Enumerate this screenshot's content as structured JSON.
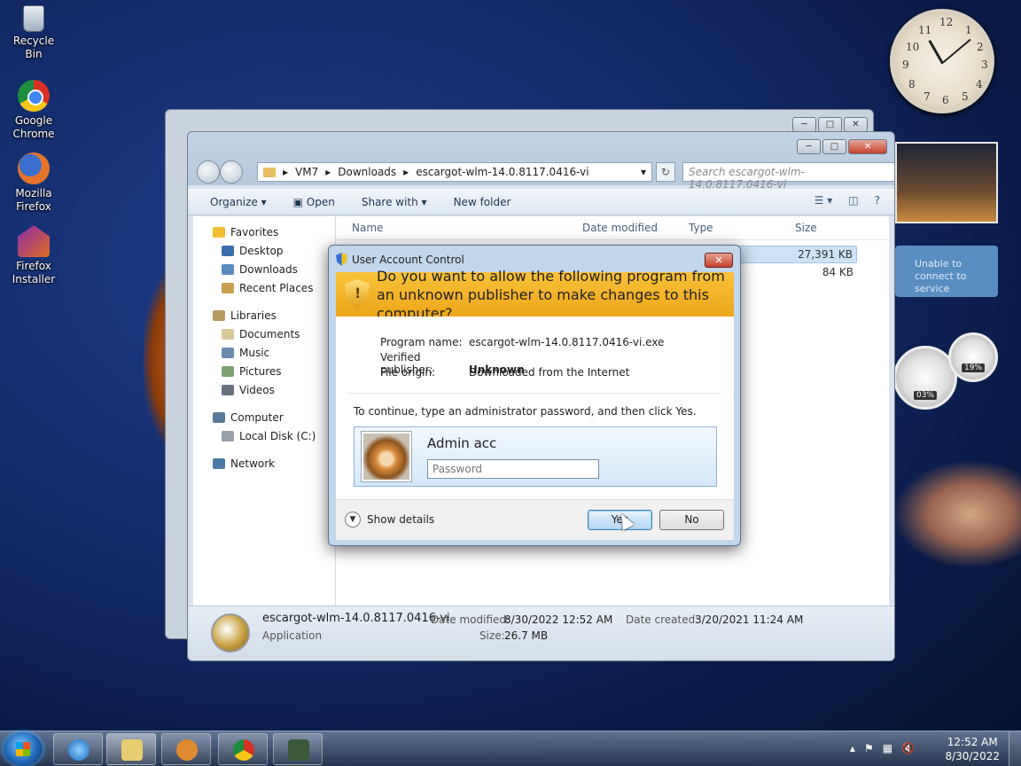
{
  "desktop": {
    "icons": [
      {
        "label": "Recycle Bin"
      },
      {
        "label": "Google Chrome"
      },
      {
        "label": "Mozilla Firefox"
      },
      {
        "label": "Firefox Installer"
      }
    ]
  },
  "gadgets": {
    "clock_numbers": [
      "12",
      "1",
      "2",
      "3",
      "4",
      "5",
      "6",
      "7",
      "8",
      "9",
      "10",
      "11"
    ],
    "info_text": "Unable to connect to service",
    "gauge_left": "03%",
    "gauge_right": "19%"
  },
  "explorer": {
    "breadcrumb": [
      "VM7",
      "Downloads",
      "escargot-wlm-14.0.8117.0416-vi"
    ],
    "search_placeholder": "Search escargot-wlm-14.0.8117.0416-vi",
    "toolbar": {
      "organize": "Organize ▾",
      "open": "Open",
      "share": "Share with ▾",
      "new_folder": "New folder"
    },
    "nav": {
      "favorites": "Favorites",
      "favorites_items": [
        "Desktop",
        "Downloads",
        "Recent Places"
      ],
      "libraries": "Libraries",
      "libraries_items": [
        "Documents",
        "Music",
        "Pictures",
        "Videos"
      ],
      "computer": "Computer",
      "computer_items": [
        "Local Disk (C:)"
      ],
      "network": "Network"
    },
    "columns": {
      "name": "Name",
      "date": "Date modified",
      "type": "Type",
      "size": "Size"
    },
    "file_sizes": [
      "27,391 KB",
      "84 KB"
    ],
    "details": {
      "filename": "escargot-wlm-14.0.8117.0416-vi",
      "filetype": "Application",
      "date_modified_label": "Date modified:",
      "date_modified": "8/30/2022 12:52 AM",
      "size_label": "Size:",
      "size": "26.7 MB",
      "date_created_label": "Date created:",
      "date_created": "3/20/2021 11:24 AM"
    }
  },
  "uac": {
    "title": "User Account Control",
    "question": "Do you want to allow the following program from an unknown publisher to make changes to this computer?",
    "program_name_label": "Program name:",
    "program_name": "escargot-wlm-14.0.8117.0416-vi.exe",
    "publisher_label": "Verified publisher:",
    "publisher": "Unknown",
    "origin_label": "File origin:",
    "origin": "Downloaded from the Internet",
    "instruction": "To continue, type an administrator password, and then click Yes.",
    "username": "Admin acc",
    "password_placeholder": "Password",
    "show_details": "Show details",
    "yes": "Yes",
    "no": "No"
  },
  "taskbar": {
    "time": "12:52 AM",
    "date": "8/30/2022"
  }
}
